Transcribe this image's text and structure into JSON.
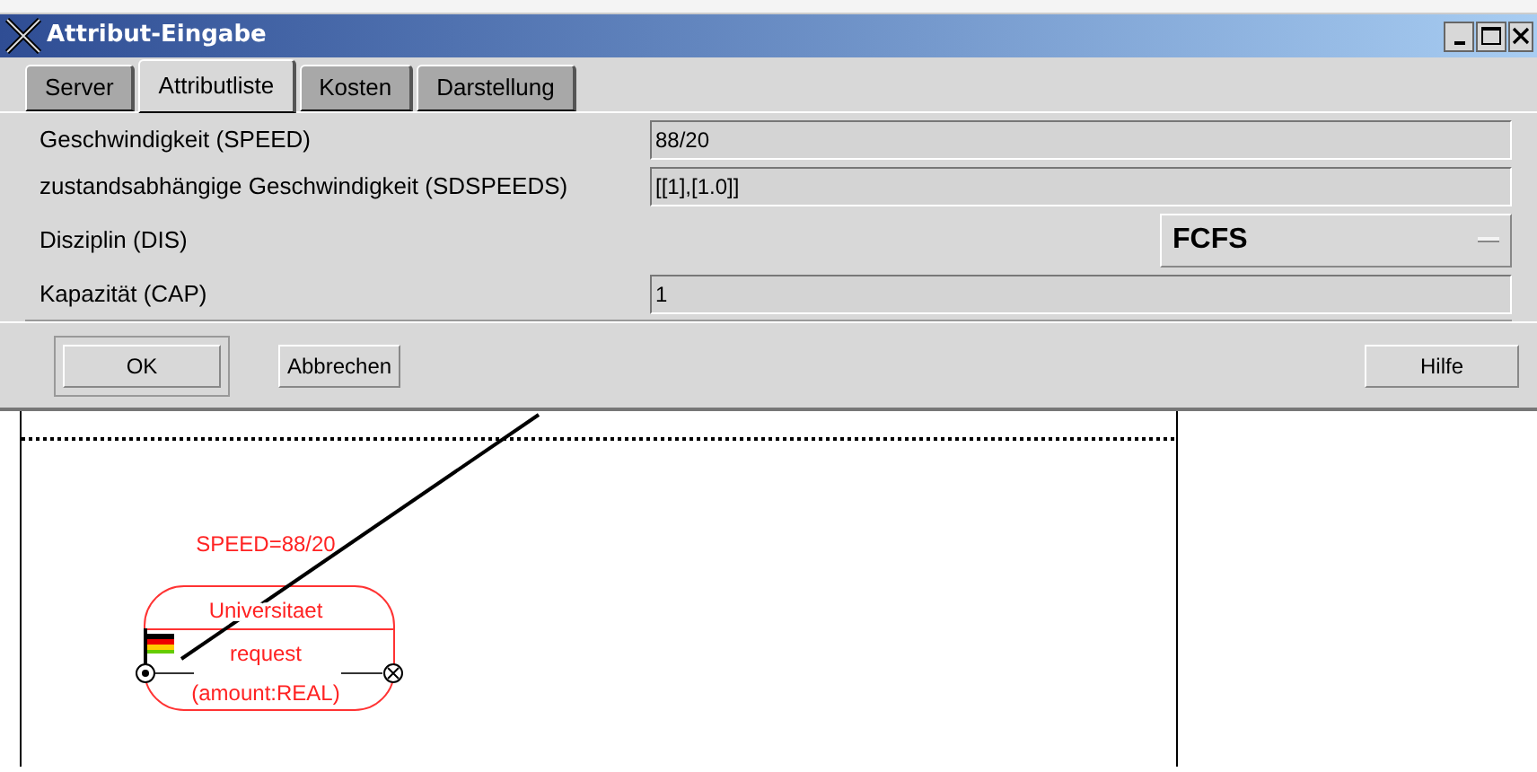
{
  "window": {
    "title": "Attribut-Eingabe"
  },
  "tabs": [
    {
      "label": "Server",
      "selected": false
    },
    {
      "label": "Attributliste",
      "selected": true
    },
    {
      "label": "Kosten",
      "selected": false
    },
    {
      "label": "Darstellung",
      "selected": false
    }
  ],
  "attributes": [
    {
      "kind": "text",
      "label": "Geschwindigkeit (SPEED)",
      "value": "88/20"
    },
    {
      "kind": "text",
      "label": "zustandsabhängige Geschwindigkeit (SDSPEEDS)",
      "value": "[[1],[1.0]]"
    },
    {
      "kind": "dropdown",
      "label": "Disziplin (DIS)",
      "value": "FCFS"
    },
    {
      "kind": "text",
      "label": "Kapazität (CAP)",
      "value": "1"
    }
  ],
  "buttons": [
    {
      "label": "OK",
      "default": true
    },
    {
      "label": "Abbrechen",
      "default": false
    },
    {
      "label": "Hilfe",
      "default": false
    }
  ],
  "canvas": {
    "annotation": "SPEED=88/20",
    "node": {
      "name": "Universitaet",
      "operation": "request",
      "parameter": "(amount:REAL)"
    }
  }
}
